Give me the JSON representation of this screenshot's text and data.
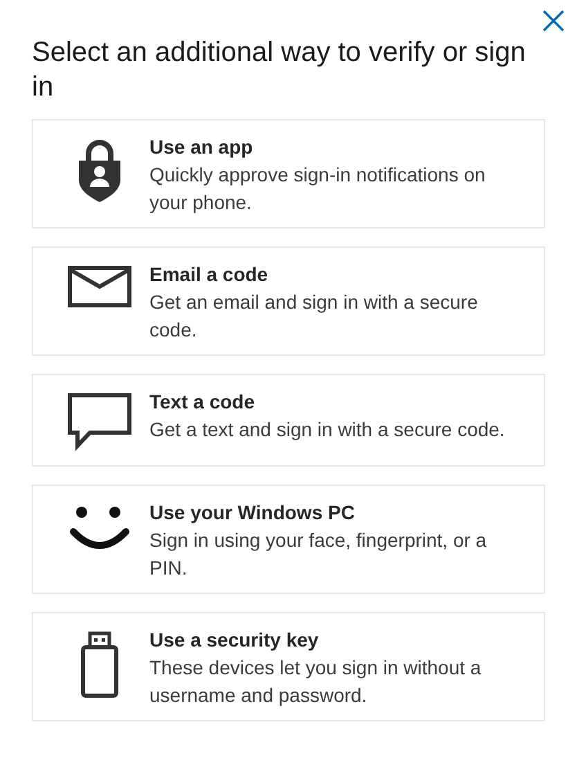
{
  "title": "Select an additional way to verify or sign in",
  "options": [
    {
      "kind": "app",
      "title": "Use an app",
      "description": "Quickly approve sign-in notifications on your phone."
    },
    {
      "kind": "email",
      "title": "Email a code",
      "description": "Get an email and sign in with a secure code."
    },
    {
      "kind": "text",
      "title": "Text a code",
      "description": "Get a text and sign in with a secure code."
    },
    {
      "kind": "windows",
      "title": "Use your Windows PC",
      "description": "Sign in using your face, fingerprint, or a PIN."
    },
    {
      "kind": "key",
      "title": "Use a security key",
      "description": "These devices let you sign in without a username and password."
    }
  ]
}
